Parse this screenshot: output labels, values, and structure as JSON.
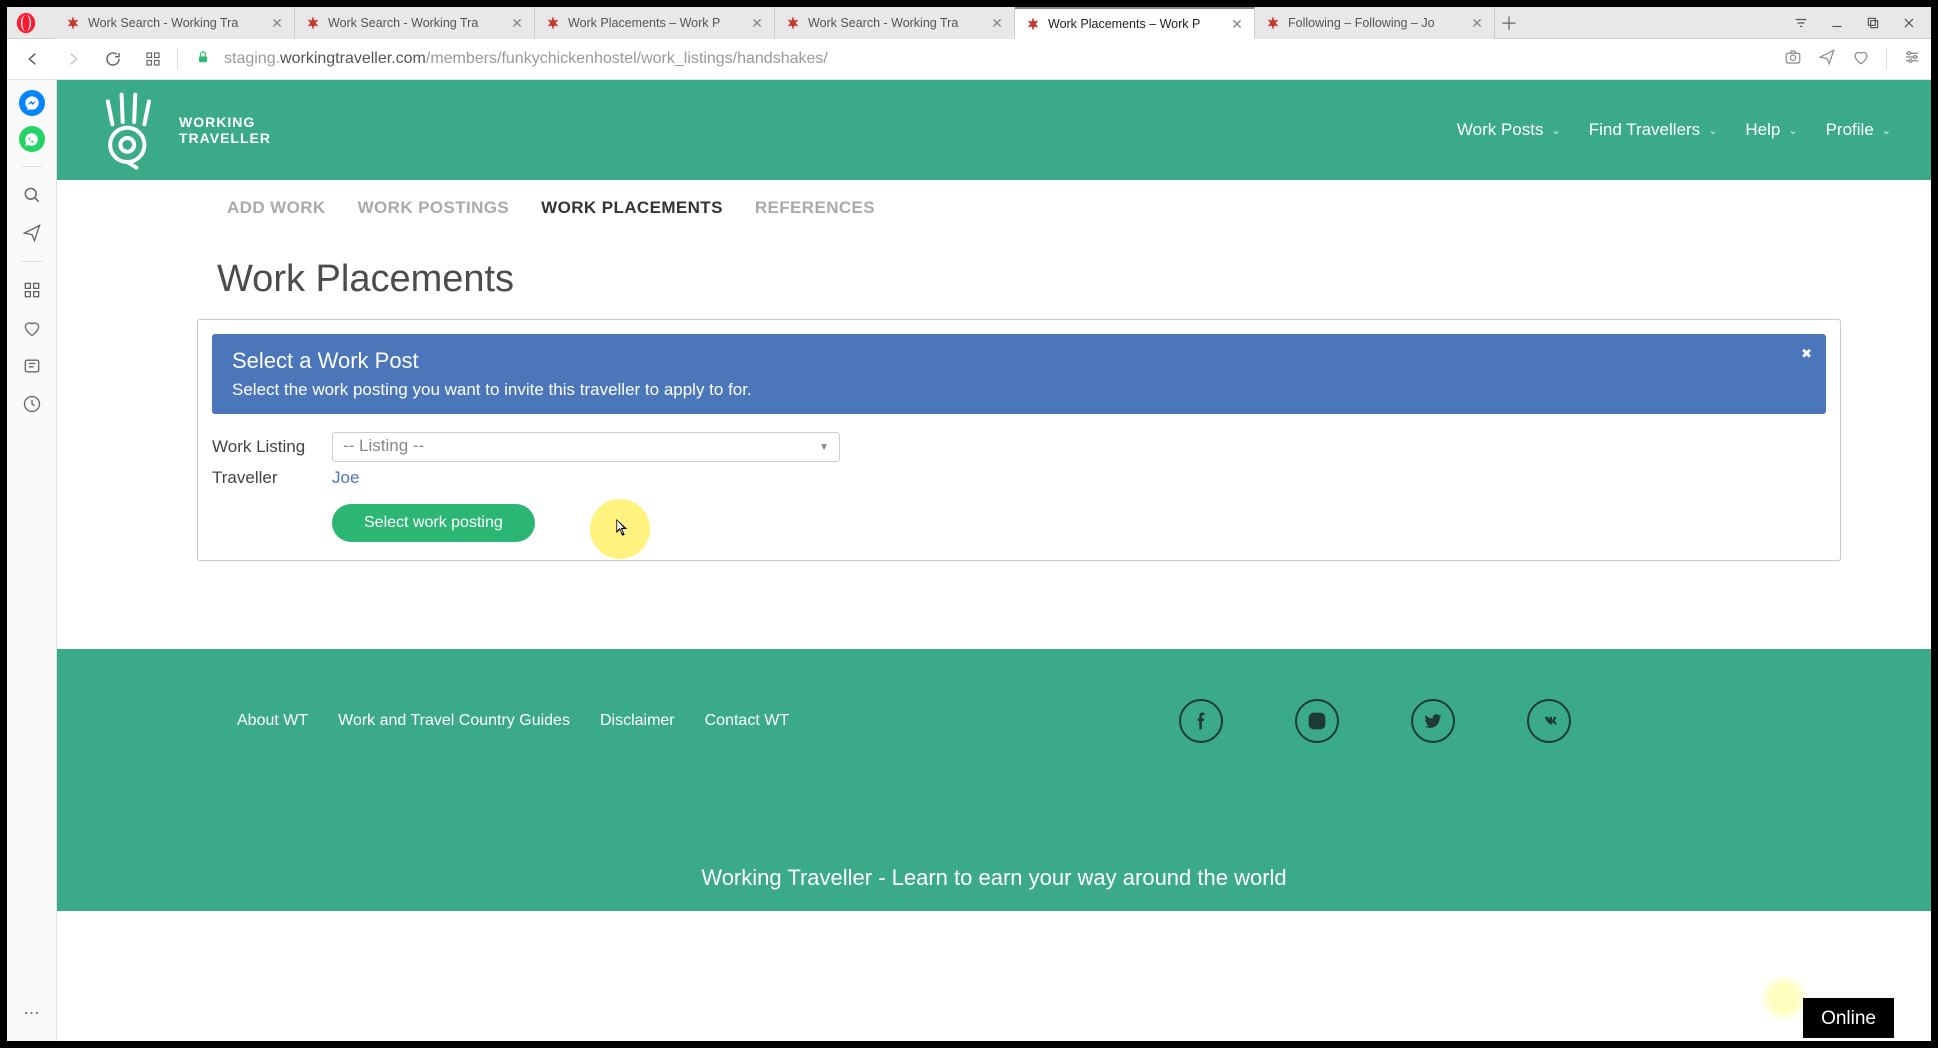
{
  "browser": {
    "tabs": [
      {
        "title": "Work Search - Working Tra"
      },
      {
        "title": "Work Search - Working Tra"
      },
      {
        "title": "Work Placements – Work P"
      },
      {
        "title": "Work Search - Working Tra"
      },
      {
        "title": "Work Placements – Work P",
        "active": true
      },
      {
        "title": "Following – Following – Jo"
      }
    ],
    "url_prefix": "staging.",
    "url_domain": "workingtraveller.com",
    "url_path": "/members/funkychickenhostel/work_listings/handshakes/"
  },
  "site_nav": {
    "logo_top": "WORKING",
    "logo_bottom": "TRAVELLER",
    "items": [
      "Work Posts",
      "Find Travellers",
      "Help",
      "Profile"
    ]
  },
  "subnav": [
    {
      "label": "ADD WORK"
    },
    {
      "label": "WORK POSTINGS"
    },
    {
      "label": "WORK PLACEMENTS",
      "active": true
    },
    {
      "label": "REFERENCES"
    }
  ],
  "page": {
    "title": "Work Placements",
    "alert_title": "Select a Work Post",
    "alert_body": "Select the work posting you want to invite this traveller to apply to for.",
    "label_listing": "Work Listing",
    "listing_value": "-- Listing --",
    "label_traveller": "Traveller",
    "traveller_name": "Joe",
    "submit_label": "Select work posting"
  },
  "footer": {
    "links": [
      "About WT",
      "Work and Travel Country Guides",
      "Disclaimer",
      "Contact WT"
    ],
    "tagline": "Working Traveller - Learn to earn your way around the world"
  },
  "online_label": "Online"
}
